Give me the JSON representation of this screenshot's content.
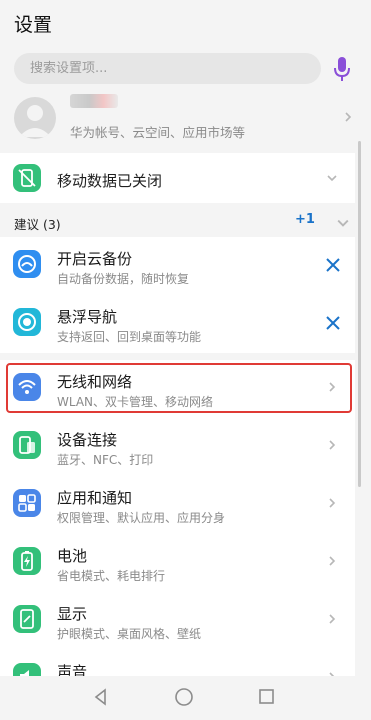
{
  "header": {
    "title": "设置"
  },
  "search": {
    "placeholder": "搜索设置项..."
  },
  "account": {
    "subtitle": "华为帐号、云空间、应用市场等"
  },
  "mobile_data": {
    "label": "移动数据已关闭"
  },
  "suggestions": {
    "header": "建议 (3)",
    "more": "+1",
    "items": [
      {
        "title": "开启云备份",
        "subtitle": "自动备份数据，随时恢复",
        "icon": "cloud-backup-icon"
      },
      {
        "title": "悬浮导航",
        "subtitle": "支持返回、回到桌面等功能",
        "icon": "floating-dock-icon"
      }
    ]
  },
  "settings": [
    {
      "title": "无线和网络",
      "subtitle": "WLAN、双卡管理、移动网络",
      "icon": "wifi-icon",
      "color": "#4a86e8",
      "highlighted": true
    },
    {
      "title": "设备连接",
      "subtitle": "蓝牙、NFC、打印",
      "icon": "device-connection-icon",
      "color": "#33c07a"
    },
    {
      "title": "应用和通知",
      "subtitle": "权限管理、默认应用、应用分身",
      "icon": "apps-icon",
      "color": "#4a86e8"
    },
    {
      "title": "电池",
      "subtitle": "省电模式、耗电排行",
      "icon": "battery-icon",
      "color": "#33c07a"
    },
    {
      "title": "显示",
      "subtitle": "护眼模式、桌面风格、壁纸",
      "icon": "display-icon",
      "color": "#33c07a"
    },
    {
      "title": "声音",
      "subtitle": "",
      "icon": "sound-icon",
      "color": "#33c07a"
    }
  ],
  "colors": {
    "accent": "#1a73c9",
    "highlight": "#e03a35",
    "mic": "#8a4fd8"
  }
}
